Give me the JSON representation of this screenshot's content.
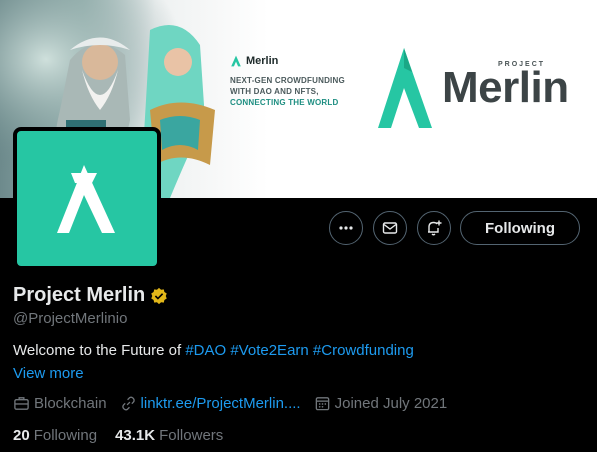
{
  "banner": {
    "small_logo": "Merlin",
    "tagline_line1": "NEXT-GEN CROWDFUNDING",
    "tagline_line2": "WITH DAO AND NFTS,",
    "tagline_line3": "CONNECTING THE WORLD",
    "logo_project": "PROJECT",
    "logo_name": "Merlin"
  },
  "actions": {
    "more_icon": "more-horizontal-icon",
    "message_icon": "envelope-icon",
    "notify_icon": "bell-plus-icon",
    "follow_label": "Following"
  },
  "profile": {
    "name": "Project Merlin",
    "verified_icon": "verified-badge-icon",
    "handle": "@ProjectMerlinio",
    "bio_prefix": "Welcome to the Future of",
    "hashtags": [
      "#DAO",
      "#Vote2Earn",
      "#Crowdfunding"
    ],
    "view_more": "View more",
    "category": "Blockchain",
    "link": "linktr.ee/ProjectMerlin....",
    "joined": "Joined July 2021"
  },
  "stats": {
    "following_count": "20",
    "following_label": "Following",
    "followers_count": "43.1K",
    "followers_label": "Followers"
  },
  "colors": {
    "accent": "#1d9bf0",
    "brand": "#26c6a3",
    "badge": "#e2b719"
  }
}
